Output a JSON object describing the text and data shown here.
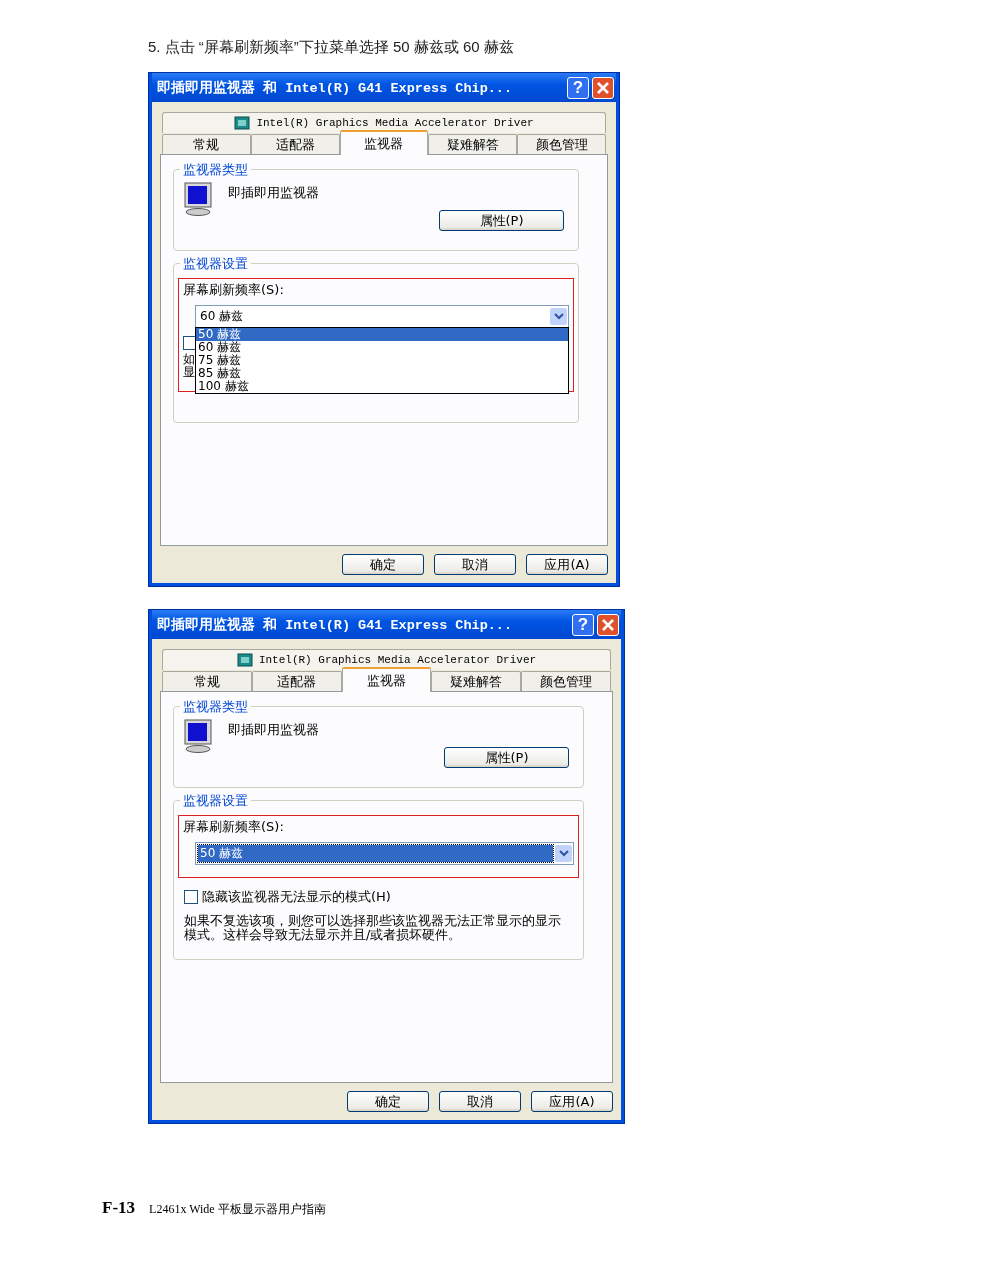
{
  "instruction": "5.  点击 “屏幕刷新频率”下拉菜单选择 50 赫兹或  60 赫兹",
  "dialogs": [
    {
      "title": "即插即用监视器 和 Intel(R) G41 Express Chip...",
      "help_button": "?",
      "driver_tab": "Intel(R) Graphics Media Accelerator Driver",
      "tabs": [
        {
          "label": "常规",
          "selected": false
        },
        {
          "label": "适配器",
          "selected": false
        },
        {
          "label": "监视器",
          "selected": true
        },
        {
          "label": "疑难解答",
          "selected": false
        },
        {
          "label": "颜色管理",
          "selected": false
        }
      ],
      "monitor_type": {
        "legend": "监视器类型",
        "name": "即插即用监视器",
        "button": "属性(P)"
      },
      "settings": {
        "legend": "监视器设置",
        "annotation_frame": true,
        "rate_label": "屏幕刷新频率(S):",
        "rate_value": "60 赫兹",
        "value_highlighted": false,
        "options": [
          {
            "label": "50 赫兹",
            "selected": true
          },
          {
            "label": "60 赫兹",
            "selected": false
          },
          {
            "label": "75 赫兹",
            "selected": false
          },
          {
            "label": "85 赫兹",
            "selected": false
          },
          {
            "label": "100 赫兹",
            "selected": false
          }
        ],
        "hide_modes": {
          "checked": false
        },
        "note_fragments": [
          "如",
          "显"
        ]
      },
      "buttons": [
        "确定",
        "取消",
        "应用(A)"
      ]
    },
    {
      "title": "即插即用监视器 和 Intel(R) G41 Express Chip...",
      "help_button": "?",
      "driver_tab": "Intel(R) Graphics Media Accelerator Driver",
      "tabs": [
        {
          "label": "常规",
          "selected": false
        },
        {
          "label": "适配器",
          "selected": false
        },
        {
          "label": "监视器",
          "selected": true
        },
        {
          "label": "疑难解答",
          "selected": false
        },
        {
          "label": "颜色管理",
          "selected": false
        }
      ],
      "monitor_type": {
        "legend": "监视器类型",
        "name": "即插即用监视器",
        "button": "属性(P)"
      },
      "settings": {
        "legend": "监视器设置",
        "annotation_frame": true,
        "rate_label": "屏幕刷新频率(S):",
        "rate_value": "50 赫兹",
        "value_highlighted": true,
        "hide_modes": {
          "checked": false,
          "label": "隐藏该监视器无法显示的模式(H)"
        },
        "note": "如果不复选该项，则您可以选择那些该监视器无法正常显示的显示模式。这样会导致无法显示并且/或者损坏硬件。"
      },
      "buttons": [
        "确定",
        "取消",
        "应用(A)"
      ]
    }
  ],
  "footer": {
    "page": "F-13",
    "title": "L2461x  Wide 平板显示器用户指南"
  }
}
